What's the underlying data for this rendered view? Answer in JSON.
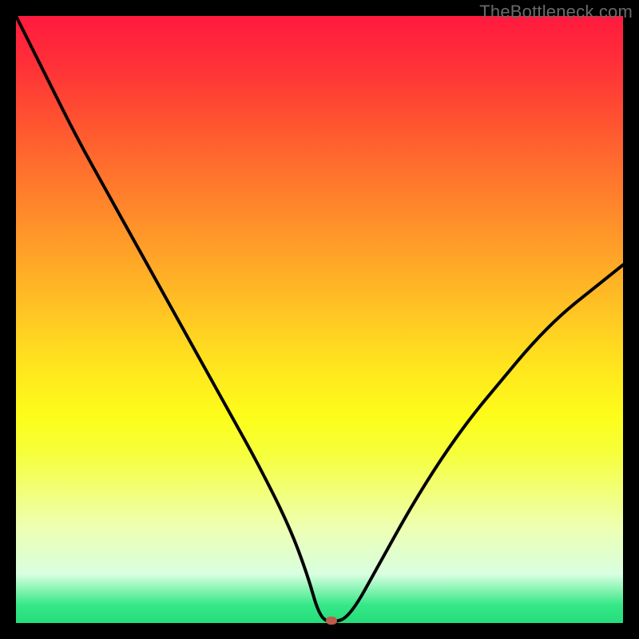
{
  "watermark": "TheBottleneck.com",
  "chart_data": {
    "type": "line",
    "title": "",
    "xlabel": "",
    "ylabel": "",
    "xlim": [
      0,
      100
    ],
    "ylim": [
      0,
      100
    ],
    "grid": false,
    "legend": false,
    "background": "red-yellow-green vertical gradient",
    "minimum_point": {
      "x": 52,
      "y": 0
    },
    "series": [
      {
        "name": "bottleneck-curve",
        "x": [
          0,
          5,
          10,
          15,
          20,
          25,
          30,
          35,
          40,
          45,
          48,
          50,
          52,
          55,
          60,
          65,
          70,
          75,
          80,
          85,
          90,
          95,
          100
        ],
        "y": [
          100,
          90,
          80,
          71,
          62,
          53,
          44,
          35,
          26,
          16,
          8,
          1,
          0,
          1,
          10,
          19,
          27,
          34,
          40,
          46,
          51,
          55,
          59
        ]
      }
    ]
  },
  "colors": {
    "curve": "#000000",
    "marker": "#c05a4a",
    "frame": "#000000"
  }
}
